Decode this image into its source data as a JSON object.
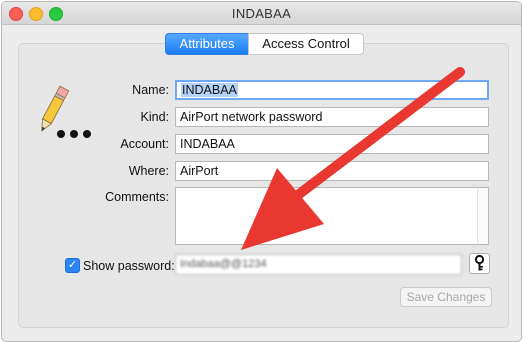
{
  "window": {
    "title": "INDABAA"
  },
  "tabs": [
    {
      "label": "Attributes",
      "active": true
    },
    {
      "label": "Access Control",
      "active": false
    }
  ],
  "fields": {
    "name_label": "Name:",
    "name_value": "INDABAA",
    "kind_label": "Kind:",
    "kind_value": "AirPort network password",
    "account_label": "Account:",
    "account_value": "INDABAA",
    "where_label": "Where:",
    "where_value": "AirPort",
    "comments_label": "Comments:",
    "comments_value": ""
  },
  "password": {
    "show_label": "Show password:",
    "checked": true,
    "value": "Indabaa@@1234"
  },
  "buttons": {
    "save_label": "Save Changes"
  },
  "icons": {
    "item": "keychain-password-pencil-icon",
    "key": "key-icon",
    "arrow": "annotation-red-arrow"
  },
  "colors": {
    "accent": "#1b7df4",
    "arrow": "#e8382f",
    "close": "#fc5f57",
    "minimize": "#fdbc2e",
    "zoom": "#28c840"
  }
}
